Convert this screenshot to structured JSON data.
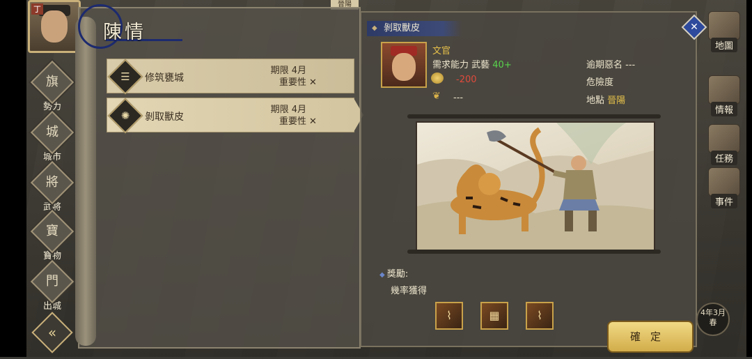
{
  "top_badge": "晉陽",
  "avatar_tag": "丁",
  "left_nav": [
    {
      "label": "勢力",
      "icon": "faction-icon",
      "glyph": "旗"
    },
    {
      "label": "城市",
      "icon": "city-icon",
      "glyph": "城"
    },
    {
      "label": "武將",
      "icon": "general-icon",
      "glyph": "將"
    },
    {
      "label": "寶物",
      "icon": "treasure-icon",
      "glyph": "寶"
    },
    {
      "label": "出城",
      "icon": "gate-icon",
      "glyph": "門"
    }
  ],
  "back_glyph": "«",
  "panel_title": "陳情",
  "tasks": [
    {
      "name": "修筑甕城",
      "deadline": "期限 4月",
      "importance": "重要性",
      "importance_mark": "✕"
    },
    {
      "name": "剝取獸皮",
      "deadline": "期限 4月",
      "importance": "重要性",
      "importance_mark": "✕"
    }
  ],
  "detail": {
    "title": "剝取獸皮",
    "role": "文官",
    "requirement_label": "需求能力 武藝",
    "requirement_value": "40+",
    "gold_value": "-200",
    "food_value": "---",
    "overdue_label": "逾期惡名 ---",
    "danger_label": "危險度",
    "location_label": "地點",
    "location_value": "晉陽",
    "reward_label": "獎勵:",
    "chance_label": "幾率獲得",
    "confirm_label": "確定"
  },
  "right_nav": [
    {
      "label": "地圖",
      "icon": "map-icon"
    },
    {
      "label": "情報",
      "icon": "intel-icon"
    },
    {
      "label": "任務",
      "icon": "quest-icon"
    },
    {
      "label": "事件",
      "icon": "event-icon"
    }
  ],
  "close_glyph": "✕",
  "date_line1": "4年3月",
  "date_line2": "春",
  "colors": {
    "accent_gold": "#e7c24a",
    "requirement_green": "#59d34c",
    "cost_red": "#e04a3c",
    "title_blue": "#2d3a66"
  }
}
